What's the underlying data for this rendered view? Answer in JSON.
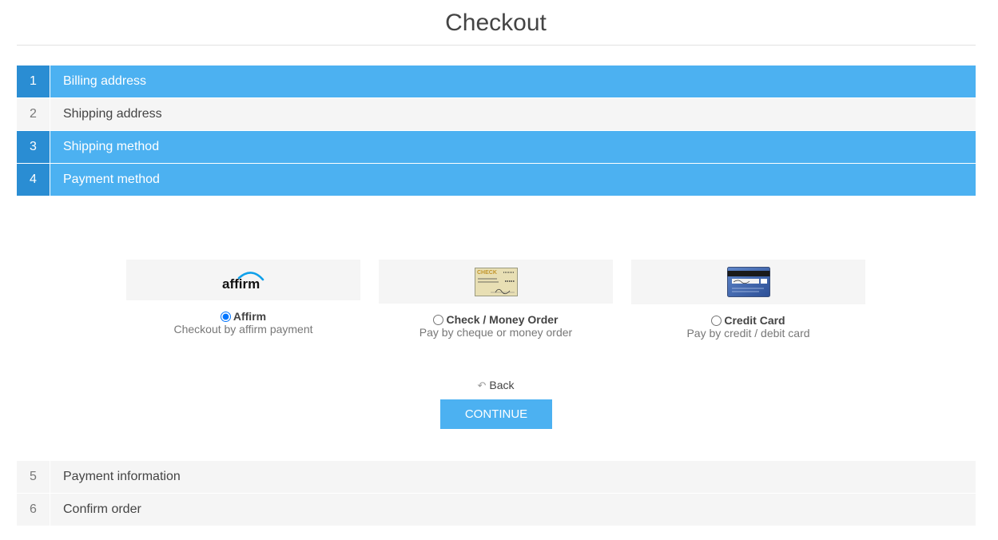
{
  "page": {
    "title": "Checkout"
  },
  "steps": [
    {
      "number": "1",
      "label": "Billing address",
      "state": "active"
    },
    {
      "number": "2",
      "label": "Shipping address",
      "state": "inactive"
    },
    {
      "number": "3",
      "label": "Shipping method",
      "state": "active"
    },
    {
      "number": "4",
      "label": "Payment method",
      "state": "active"
    },
    {
      "number": "5",
      "label": "Payment information",
      "state": "inactive"
    },
    {
      "number": "6",
      "label": "Confirm order",
      "state": "inactive"
    }
  ],
  "payment_methods": [
    {
      "name": "Affirm",
      "description": "Checkout by affirm payment",
      "selected": true,
      "logo_text": "affirm",
      "icon": "affirm-logo-icon"
    },
    {
      "name": "Check / Money Order",
      "description": "Pay by cheque or money order",
      "selected": false,
      "logo_text": "CHECK",
      "icon": "check-money-order-icon"
    },
    {
      "name": "Credit Card",
      "description": "Pay by credit / debit card",
      "selected": false,
      "icon": "credit-card-icon"
    }
  ],
  "actions": {
    "back_label": "Back",
    "continue_label": "CONTINUE"
  },
  "colors": {
    "accent": "#4cb1f1",
    "accent_dark": "#2a8dd3",
    "inactive_bg": "#f5f5f5",
    "text": "#444444",
    "muted": "#777777"
  }
}
